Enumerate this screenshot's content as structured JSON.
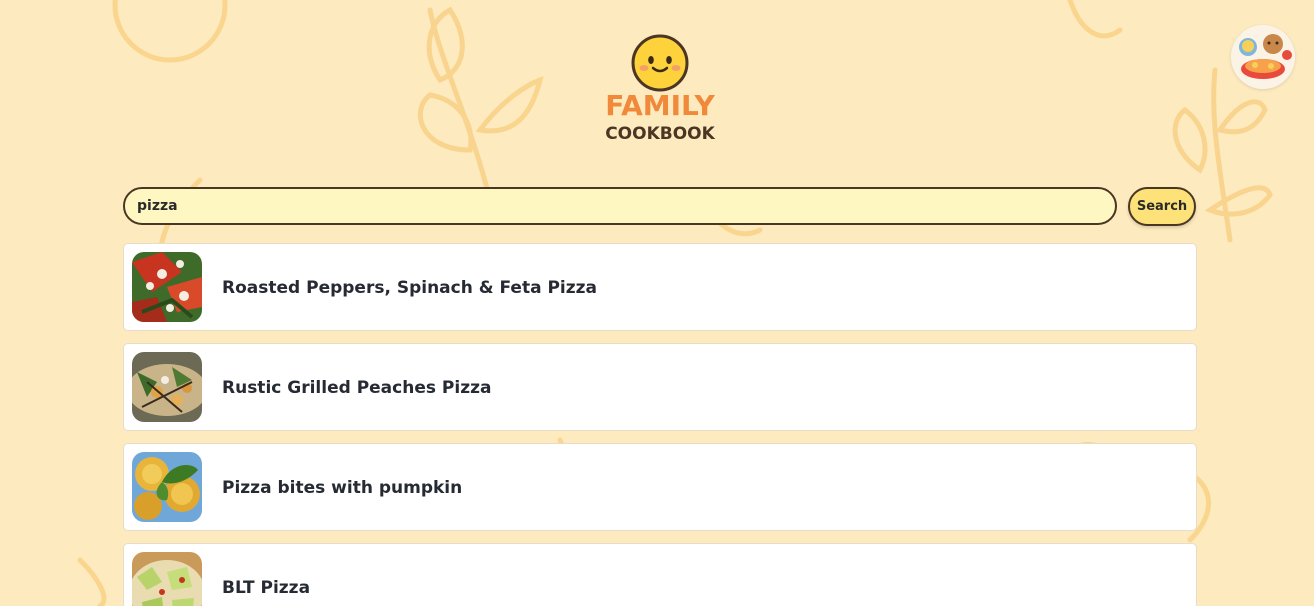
{
  "app": {
    "logo_line1": "FAMILY",
    "logo_line2": "COOKBOOK"
  },
  "search": {
    "value": "pizza",
    "button_label": "Search"
  },
  "results": [
    {
      "title": "Roasted Peppers, Spinach & Feta Pizza",
      "thumb": "roasted-peppers-pizza-photo"
    },
    {
      "title": "Rustic Grilled Peaches Pizza",
      "thumb": "grilled-peaches-pizza-photo"
    },
    {
      "title": "Pizza bites with pumpkin",
      "thumb": "pumpkin-pizza-bites-photo"
    },
    {
      "title": "BLT Pizza",
      "thumb": "blt-pizza-photo"
    }
  ],
  "colors": {
    "background": "#fdeabf",
    "doodle": "#f8cd7e",
    "logo_orange": "#f08a3a",
    "logo_brown": "#4b3523",
    "input_fill": "#fff7c2",
    "button_fill": "#fde27a"
  },
  "icons": {
    "logo": "smiley-face-icon",
    "avatar": "food-characters-avatar"
  }
}
